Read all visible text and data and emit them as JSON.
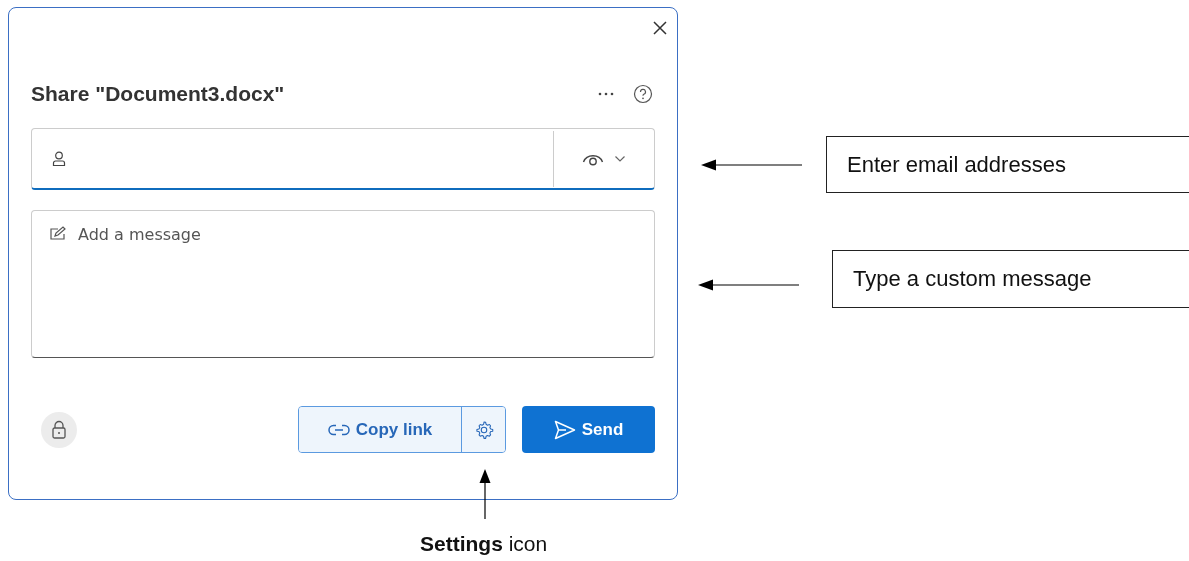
{
  "dialog": {
    "title": "Share \"Document3.docx\"",
    "email_field": {
      "focused": true
    },
    "message_field": {
      "placeholder": "Add a message"
    },
    "copy_link_button": {
      "label": "Copy link"
    },
    "send_button": {
      "label": "Send"
    }
  },
  "annotations": [
    {
      "kind": "callout",
      "text": "Enter email addresses"
    },
    {
      "kind": "callout",
      "text": "Type a custom message"
    },
    {
      "kind": "caption",
      "text": "**Settings** icon"
    }
  ]
}
